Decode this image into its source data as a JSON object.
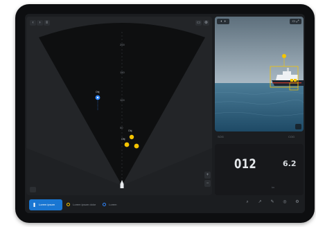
{
  "sonar": {
    "range_labels": [
      "200",
      "150",
      "100",
      "50"
    ],
    "targets": [
      {
        "label": "Obj",
        "state": "tracked"
      },
      {
        "label": "Obj",
        "state": "alert"
      },
      {
        "label": "Obj",
        "state": "alert"
      }
    ],
    "buttons": {
      "top_left": [
        "‹",
        "›",
        "≡"
      ],
      "top_right": [
        "▭",
        "⊕"
      ],
      "zoom_in": "+",
      "zoom_out": "−"
    }
  },
  "camera": {
    "buttons": {
      "left": "◐ ◑",
      "right": "▭ ⤢"
    }
  },
  "mid_strip": {
    "left": "SOG",
    "right": "COG"
  },
  "readout": {
    "primary_value": "012",
    "secondary_value": "6.2",
    "hint": "kn"
  },
  "toolbar": {
    "primary_button": "Lorem ipsum",
    "item_1": "Lorem ipsum dolor",
    "item_2": "Lorem",
    "tools": [
      {
        "glyph": "⌕",
        "label": ""
      },
      {
        "glyph": "↗",
        "label": ""
      },
      {
        "glyph": "✎",
        "label": ""
      },
      {
        "glyph": "◎",
        "label": ""
      },
      {
        "glyph": "⚙",
        "label": ""
      }
    ]
  },
  "colors": {
    "accent_blue": "#1976d2",
    "alert_yellow": "#f5c400",
    "tracked_blue": "#2e86ff",
    "sonar_cone": "#0e0f10",
    "background": "#1f2124"
  }
}
